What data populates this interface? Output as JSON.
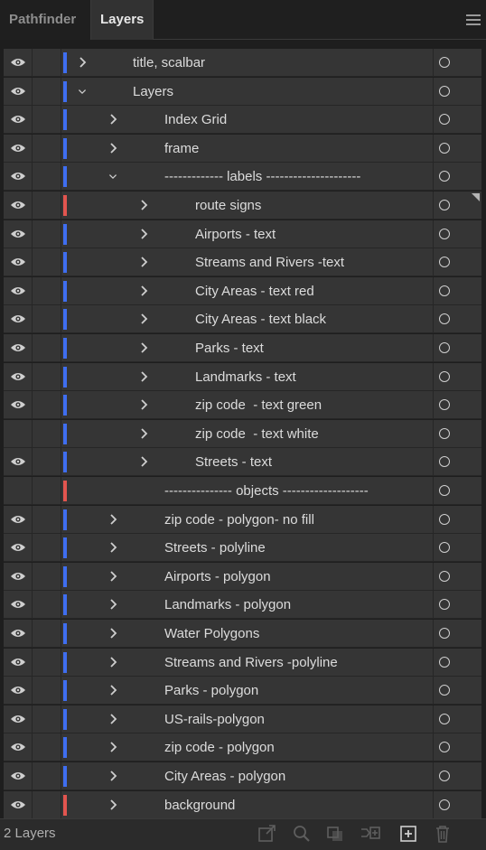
{
  "tabs": [
    {
      "label": "Pathfinder"
    },
    {
      "label": "Layers"
    }
  ],
  "footer": {
    "layer_count": "2 Layers"
  },
  "colors": {
    "blue": "#3f6ef0",
    "red": "#e2554f"
  },
  "layers": [
    {
      "label": "title, scalbar",
      "depth": 0,
      "expanded": false,
      "visible": true,
      "color": "blue",
      "has_children": true
    },
    {
      "label": "Layers",
      "depth": 0,
      "expanded": true,
      "visible": true,
      "color": "blue",
      "has_children": true
    },
    {
      "label": "Index Grid",
      "depth": 1,
      "expanded": false,
      "visible": true,
      "color": "blue",
      "has_children": true
    },
    {
      "label": "frame",
      "depth": 1,
      "expanded": false,
      "visible": true,
      "color": "blue",
      "has_children": true
    },
    {
      "label": "------------- labels ---------------------",
      "depth": 1,
      "expanded": true,
      "visible": true,
      "color": "blue",
      "has_children": true
    },
    {
      "label": "route signs",
      "depth": 2,
      "expanded": false,
      "visible": true,
      "color": "red",
      "has_children": true
    },
    {
      "label": "Airports - text",
      "depth": 2,
      "expanded": false,
      "visible": true,
      "color": "blue",
      "has_children": true
    },
    {
      "label": "Streams and Rivers -text",
      "depth": 2,
      "expanded": false,
      "visible": true,
      "color": "blue",
      "has_children": true
    },
    {
      "label": "City Areas - text red",
      "depth": 2,
      "expanded": false,
      "visible": true,
      "color": "blue",
      "has_children": true
    },
    {
      "label": "City Areas - text black",
      "depth": 2,
      "expanded": false,
      "visible": true,
      "color": "blue",
      "has_children": true
    },
    {
      "label": "Parks - text",
      "depth": 2,
      "expanded": false,
      "visible": true,
      "color": "blue",
      "has_children": true
    },
    {
      "label": "Landmarks - text",
      "depth": 2,
      "expanded": false,
      "visible": true,
      "color": "blue",
      "has_children": true
    },
    {
      "label": "zip code  - text green",
      "depth": 2,
      "expanded": false,
      "visible": true,
      "color": "blue",
      "has_children": true
    },
    {
      "label": "zip code  - text white",
      "depth": 2,
      "expanded": false,
      "visible": false,
      "color": "blue",
      "has_children": true
    },
    {
      "label": "Streets - text",
      "depth": 2,
      "expanded": false,
      "visible": true,
      "color": "blue",
      "has_children": true
    },
    {
      "label": "--------------- objects -------------------",
      "depth": 1,
      "expanded": false,
      "visible": false,
      "color": "red",
      "has_children": false
    },
    {
      "label": "zip code - polygon- no fill",
      "depth": 1,
      "expanded": false,
      "visible": true,
      "color": "blue",
      "has_children": true
    },
    {
      "label": "Streets - polyline",
      "depth": 1,
      "expanded": false,
      "visible": true,
      "color": "blue",
      "has_children": true
    },
    {
      "label": "Airports - polygon",
      "depth": 1,
      "expanded": false,
      "visible": true,
      "color": "blue",
      "has_children": true
    },
    {
      "label": "Landmarks - polygon",
      "depth": 1,
      "expanded": false,
      "visible": true,
      "color": "blue",
      "has_children": true
    },
    {
      "label": "Water Polygons",
      "depth": 1,
      "expanded": false,
      "visible": true,
      "color": "blue",
      "has_children": true
    },
    {
      "label": "Streams and Rivers -polyline",
      "depth": 1,
      "expanded": false,
      "visible": true,
      "color": "blue",
      "has_children": true
    },
    {
      "label": "Parks - polygon",
      "depth": 1,
      "expanded": false,
      "visible": true,
      "color": "blue",
      "has_children": true
    },
    {
      "label": "US-rails-polygon",
      "depth": 1,
      "expanded": false,
      "visible": true,
      "color": "blue",
      "has_children": true
    },
    {
      "label": "zip code - polygon",
      "depth": 1,
      "expanded": false,
      "visible": true,
      "color": "blue",
      "has_children": true
    },
    {
      "label": "City Areas - polygon",
      "depth": 1,
      "expanded": false,
      "visible": true,
      "color": "blue",
      "has_children": true
    },
    {
      "label": "background",
      "depth": 1,
      "expanded": false,
      "visible": true,
      "color": "red",
      "has_children": true
    }
  ],
  "footer_icons": [
    "export-icon",
    "locate-object-icon",
    "clipping-mask-icon",
    "new-sublayer-icon",
    "new-layer-icon",
    "delete-icon"
  ]
}
